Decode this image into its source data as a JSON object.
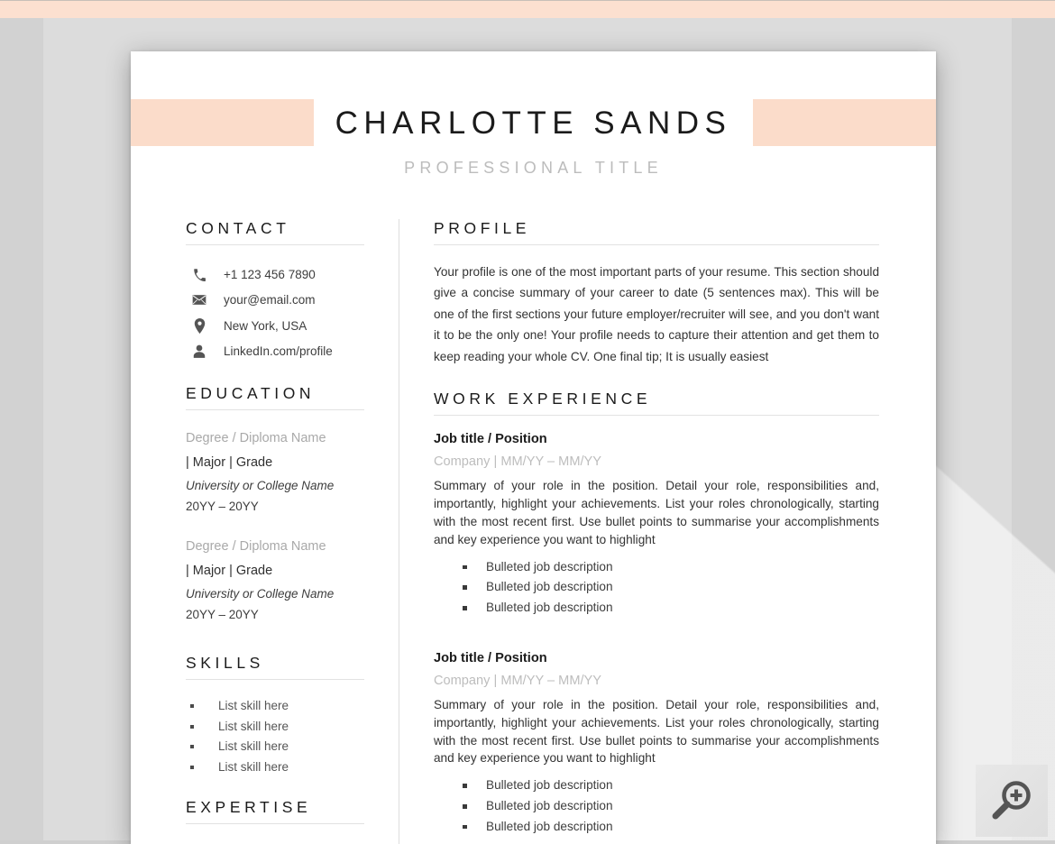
{
  "header": {
    "name": "CHARLOTTE SANDS",
    "subtitle": "PROFESSIONAL TITLE"
  },
  "sidebar": {
    "contact": {
      "title": "CONTACT",
      "items": [
        {
          "icon": "phone-icon",
          "text": "+1 123 456 7890"
        },
        {
          "icon": "envelope-icon",
          "text": "your@email.com"
        },
        {
          "icon": "location-pin-icon",
          "text": "New York, USA"
        },
        {
          "icon": "person-icon",
          "text": "LinkedIn.com/profile"
        }
      ]
    },
    "education": {
      "title": "EDUCATION",
      "entries": [
        {
          "degree": "Degree / Diploma Name",
          "major": "| Major | Grade",
          "school": "University or College Name",
          "dates": "20YY – 20YY"
        },
        {
          "degree": "Degree / Diploma Name",
          "major": "| Major | Grade",
          "school": "University or College Name",
          "dates": "20YY – 20YY"
        }
      ]
    },
    "skills": {
      "title": "SKILLS",
      "items": [
        "List skill here",
        "List skill here",
        "List skill here",
        "List skill here"
      ]
    },
    "expertise": {
      "title": "EXPERTISE"
    }
  },
  "main": {
    "profile": {
      "title": "PROFILE",
      "text": "Your profile is one of the most important parts of your resume. This section should give a concise summary of your career to date (5 sentences max). This will be one of the first sections your future employer/recruiter will see, and you don't want it to be the only one! Your profile needs to capture their attention and get them to keep reading your whole CV. One final tip; It is usually easiest"
    },
    "work": {
      "title": "WORK EXPERIENCE",
      "jobs": [
        {
          "title": "Job title / Position",
          "meta": "Company |  MM/YY – MM/YY",
          "summary": "Summary of your role in the position. Detail your role, responsibilities and, importantly, highlight your achievements. List your roles chronologically, starting with the most recent first. Use bullet points to summarise your accomplishments and key experience you want to highlight",
          "bullets": [
            "Bulleted job description",
            "Bulleted job description",
            "Bulleted job description"
          ]
        },
        {
          "title": "Job title / Position",
          "meta": "Company |  MM/YY – MM/YY",
          "summary": "Summary of your role in the position. Detail your role, responsibilities and, importantly, highlight your achievements. List your roles chronologically, starting with the most recent first. Use bullet points to summarise your accomplishments and key experience you want to highlight",
          "bullets": [
            "Bulleted job description",
            "Bulleted job description",
            "Bulleted job description"
          ]
        }
      ]
    }
  },
  "overlay": {
    "zoom_badge_icon": "magnifier-plus-icon"
  },
  "colors": {
    "accent_peach": "#fbdcca",
    "top_strip": "#fce0d0",
    "page_background": "#ffffff",
    "backdrop": "#d2d2d2",
    "backdrop_inner": "#dcdcdc",
    "heading_text": "#1b1b1b",
    "muted_text": "#bdbdbd",
    "body_text": "#333333"
  }
}
